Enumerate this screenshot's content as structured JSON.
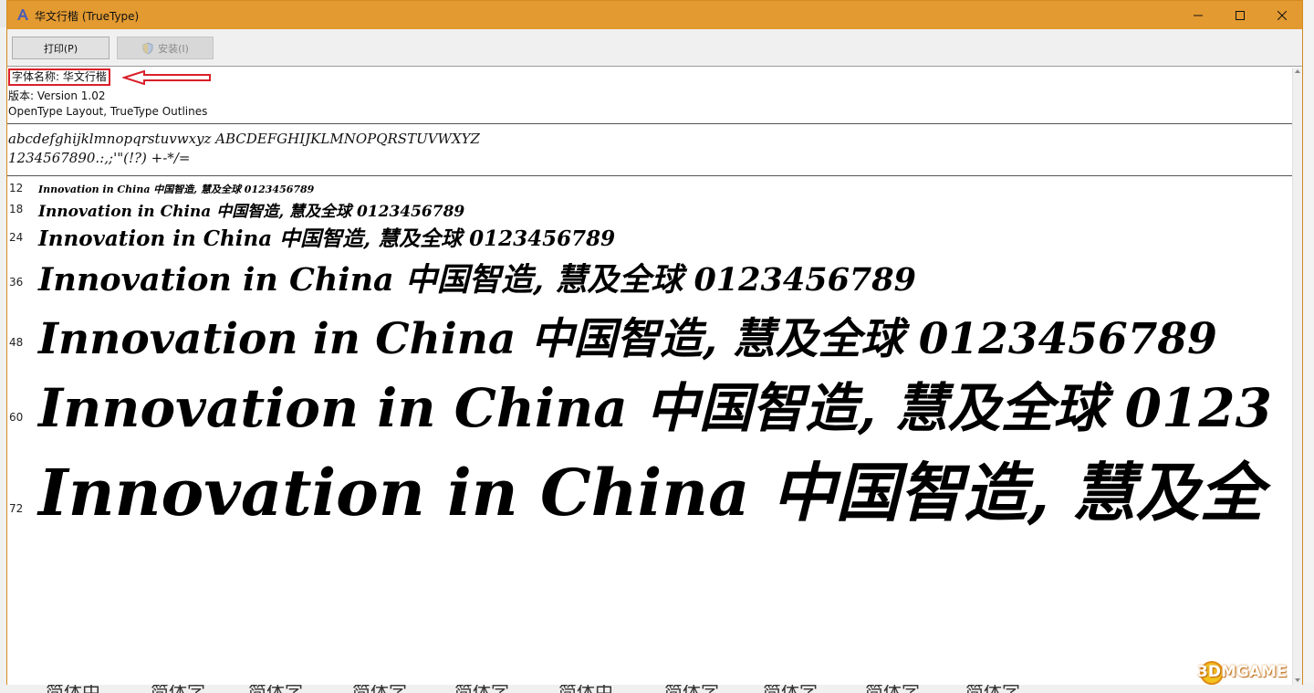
{
  "window": {
    "title": "华文行楷 (TrueType)"
  },
  "toolbar": {
    "print_label": "打印(P)",
    "install_label": "安装(I)"
  },
  "info": {
    "font_name": "字体名称: 华文行楷",
    "version": "版本: Version 1.02",
    "type": "OpenType Layout, TrueType Outlines"
  },
  "charset": {
    "letters": "abcdefghijklmnopqrstuvwxyz ABCDEFGHIJKLMNOPQRSTUVWXYZ",
    "digits": "1234567890.:,;'\"(!?) +-*/="
  },
  "samples": [
    {
      "size": "12",
      "text": "Innovation in China 中国智造, 慧及全球 0123456789"
    },
    {
      "size": "18",
      "text": "Innovation in China 中国智造, 慧及全球 0123456789"
    },
    {
      "size": "24",
      "text": "Innovation in China 中国智造, 慧及全球 0123456789"
    },
    {
      "size": "36",
      "text": "Innovation in China 中国智造, 慧及全球 0123456789"
    },
    {
      "size": "48",
      "text": "Innovation in China 中国智造, 慧及全球 0123456789"
    },
    {
      "size": "60",
      "text": "Innovation in China 中国智造, 慧及全球 0123"
    },
    {
      "size": "72",
      "text": "Innovation in China 中国智造, 慧及全"
    }
  ],
  "background_text": [
    "简体中",
    "简体字",
    "简体字",
    "简体字",
    "简体字",
    "简体中",
    "简体字",
    "简体字",
    "简体字",
    "简体字"
  ],
  "watermark": "3DMGAME",
  "colors": {
    "titlebar": "#e39a31",
    "highlight": "#d9202a"
  }
}
